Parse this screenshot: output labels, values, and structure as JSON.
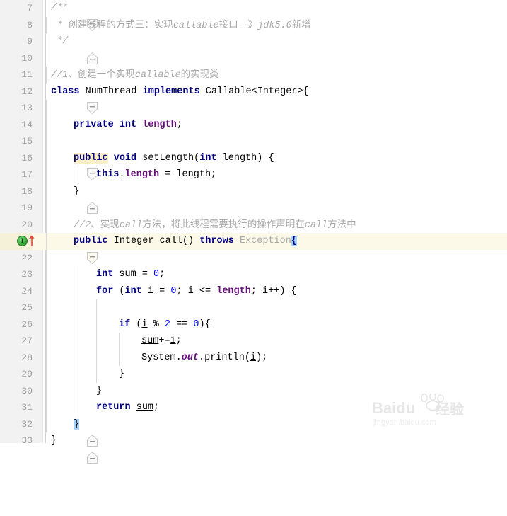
{
  "editor": {
    "language": "java",
    "current_line": 21,
    "first_line": 7,
    "last_line": 33,
    "colors": {
      "keyword": "#000080",
      "field": "#660e7a",
      "number": "#0000ff",
      "comment": "#a8a8a8",
      "gutter_bg": "#f2f2f2",
      "current_line_bg": "#fcf9e9",
      "brace_match_bg": "#a6d2ff",
      "keyword_highlight_bg": "#faeec8"
    },
    "gutter_icons": {
      "implements_marker": "implements-method-icon",
      "override_arrow": "up-arrow-icon"
    },
    "lines": [
      {
        "n": "7",
        "indent": 0,
        "fold": "start",
        "text": "/**"
      },
      {
        "n": "8",
        "indent": 0,
        "fold": "none",
        "text": " * 创建线程的方式三：实现callable接口 --》jdk5.0新增"
      },
      {
        "n": "9",
        "indent": 0,
        "fold": "end",
        "text": " */"
      },
      {
        "n": "10",
        "indent": 0,
        "fold": "none",
        "text": ""
      },
      {
        "n": "11",
        "indent": 0,
        "fold": "none",
        "text": "//1、创建一个实现callable的实现类"
      },
      {
        "n": "12",
        "indent": 0,
        "fold": "start",
        "text": "class NumThread implements Callable<Integer>{"
      },
      {
        "n": "13",
        "indent": 0,
        "fold": "none",
        "text": ""
      },
      {
        "n": "14",
        "indent": 1,
        "fold": "none",
        "text": "private int length;"
      },
      {
        "n": "15",
        "indent": 0,
        "fold": "none",
        "text": ""
      },
      {
        "n": "16",
        "indent": 1,
        "fold": "start",
        "text": "public void setLength(int length) {"
      },
      {
        "n": "17",
        "indent": 2,
        "fold": "none",
        "text": "this.length = length;"
      },
      {
        "n": "18",
        "indent": 1,
        "fold": "end",
        "text": "}"
      },
      {
        "n": "19",
        "indent": 0,
        "fold": "none",
        "text": ""
      },
      {
        "n": "20",
        "indent": 1,
        "fold": "none",
        "text": "//2、实现call方法，将此线程需要执行的操作声明在call方法中"
      },
      {
        "n": "21",
        "indent": 1,
        "fold": "start",
        "text": "public Integer call() throws Exception{"
      },
      {
        "n": "22",
        "indent": 0,
        "fold": "none",
        "text": ""
      },
      {
        "n": "23",
        "indent": 2,
        "fold": "none",
        "text": "int sum = 0;"
      },
      {
        "n": "24",
        "indent": 2,
        "fold": "none",
        "text": "for (int i = 0; i <= length; i++) {"
      },
      {
        "n": "25",
        "indent": 0,
        "fold": "none",
        "text": ""
      },
      {
        "n": "26",
        "indent": 3,
        "fold": "none",
        "text": "if (i % 2 == 0){"
      },
      {
        "n": "27",
        "indent": 4,
        "fold": "none",
        "text": "sum+=i;"
      },
      {
        "n": "28",
        "indent": 4,
        "fold": "none",
        "text": "System.out.println(i);"
      },
      {
        "n": "29",
        "indent": 3,
        "fold": "none",
        "text": "}"
      },
      {
        "n": "30",
        "indent": 2,
        "fold": "none",
        "text": "}"
      },
      {
        "n": "31",
        "indent": 2,
        "fold": "none",
        "text": "return sum;"
      },
      {
        "n": "32",
        "indent": 1,
        "fold": "end",
        "text": "}"
      },
      {
        "n": "33",
        "indent": 0,
        "fold": "end",
        "text": "}"
      }
    ]
  },
  "watermark": {
    "brand": "Baidu",
    "label": "经验",
    "url": "jingyan.baidu.com"
  }
}
